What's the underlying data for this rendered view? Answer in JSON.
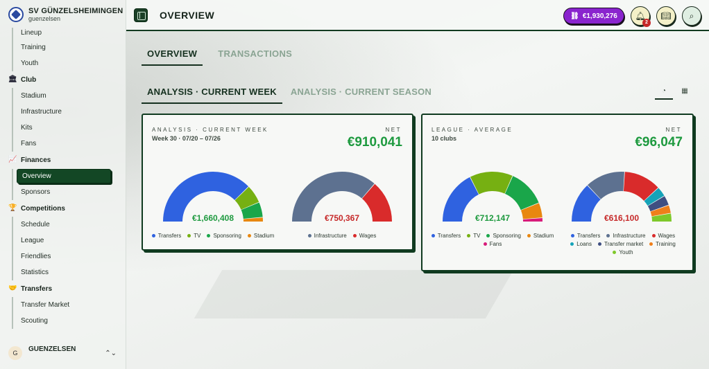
{
  "club": {
    "name": "SV GÜNZELSHEIMINGEN",
    "sub": "guenzelsen"
  },
  "sidebar": {
    "sections": [
      {
        "heading": null,
        "items": [
          "Lineup",
          "Training",
          "Youth"
        ]
      },
      {
        "heading": "Club",
        "icon": "bank-icon",
        "items": [
          "Stadium",
          "Infrastructure",
          "Kits",
          "Fans"
        ]
      },
      {
        "heading": "Finances",
        "icon": "chart-icon",
        "items": [
          "Overview",
          "Sponsors"
        ],
        "active": "Overview"
      },
      {
        "heading": "Competitions",
        "icon": "trophy-icon",
        "items": [
          "Schedule",
          "League",
          "Friendlies",
          "Statistics"
        ]
      },
      {
        "heading": "Transfers",
        "icon": "handshake-icon",
        "items": [
          "Transfer Market",
          "Scouting"
        ]
      }
    ],
    "user": {
      "initial": "G",
      "name": "GUENZELSEN"
    }
  },
  "header": {
    "title": "OVERVIEW",
    "balance": "€1,930,276",
    "notifications": "2"
  },
  "tabs": [
    "OVERVIEW",
    "TRANSACTIONS"
  ],
  "subtabs": [
    "ANALYSIS · CURRENT WEEK",
    "ANALYSIS · CURRENT SEASON"
  ],
  "colors": {
    "Transfers": "#2f62e0",
    "TV": "#76b012",
    "Sponsoring": "#1aa64a",
    "Stadium": "#e88710",
    "Fans": "#d81b7a",
    "Infrastructure": "#5d7190",
    "Wages": "#d92b2b",
    "Loans": "#16a3b8",
    "Transfer market": "#3f4f82",
    "Training": "#ef7f1a",
    "Youth": "#7ec82a"
  },
  "cards": [
    {
      "label": "ANALYSIS · CURRENT WEEK",
      "sub": "Week 30 · 07/20 – 07/26",
      "net_label": "NET",
      "net": "€910,041",
      "gauges": [
        {
          "value": "€1,660,408",
          "value_color": "#1e9a3f",
          "segments": [
            {
              "name": "Transfers",
              "value": 1250000
            },
            {
              "name": "TV",
              "value": 200000
            },
            {
              "name": "Sponsoring",
              "value": 165000
            },
            {
              "name": "Stadium",
              "value": 45408
            }
          ]
        },
        {
          "value": "€750,367",
          "value_color": "#c62828",
          "segments": [
            {
              "name": "Infrastructure",
              "value": 545000
            },
            {
              "name": "Wages",
              "value": 205367
            }
          ]
        }
      ]
    },
    {
      "label": "LEAGUE · AVERAGE",
      "sub": "10 clubs",
      "net_label": "NET",
      "net": "€96,047",
      "gauges": [
        {
          "value": "€712,147",
          "value_color": "#1e9a3f",
          "segments": [
            {
              "name": "Transfers",
              "value": 250000
            },
            {
              "name": "TV",
              "value": 200000
            },
            {
              "name": "Sponsoring",
              "value": 175000
            },
            {
              "name": "Stadium",
              "value": 70000
            },
            {
              "name": "Fans",
              "value": 17147
            }
          ]
        },
        {
          "value": "€616,100",
          "value_color": "#c62828",
          "segments": [
            {
              "name": "Transfers",
              "value": 160000
            },
            {
              "name": "Infrastructure",
              "value": 160000
            },
            {
              "name": "Wages",
              "value": 150000
            },
            {
              "name": "Loans",
              "value": 40000
            },
            {
              "name": "Transfer market",
              "value": 40000
            },
            {
              "name": "Training",
              "value": 33000
            },
            {
              "name": "Youth",
              "value": 33100
            }
          ]
        }
      ]
    }
  ]
}
